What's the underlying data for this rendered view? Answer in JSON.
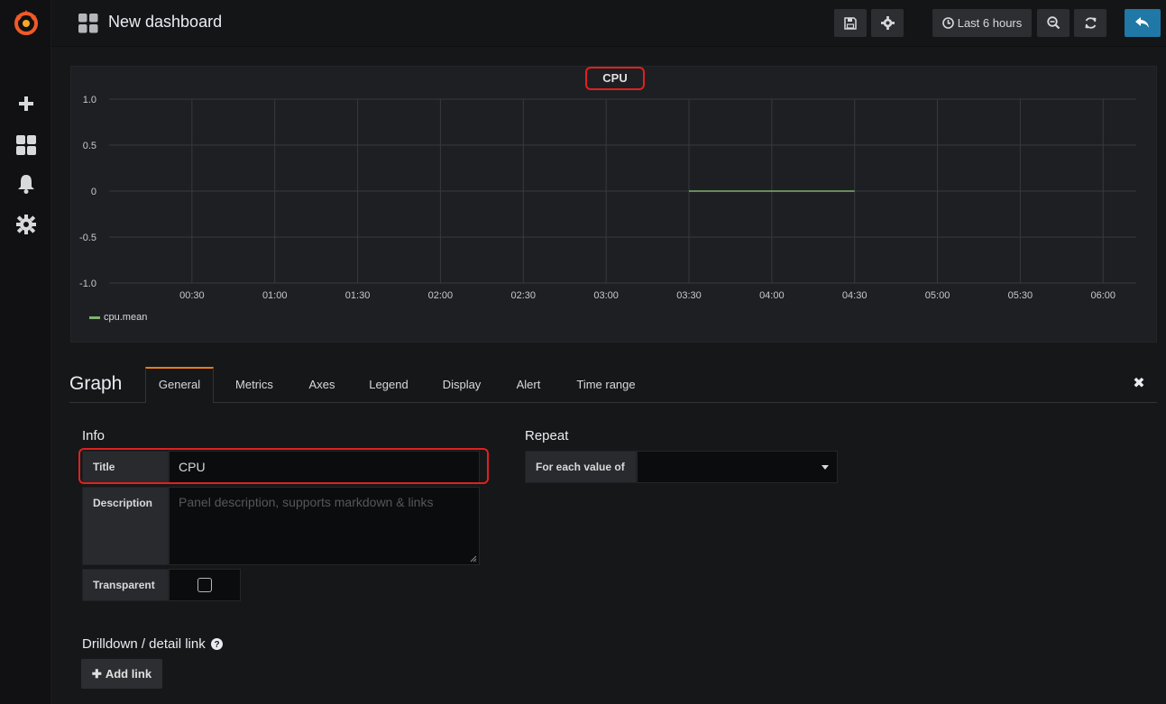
{
  "topbar": {
    "dashboard_title": "New dashboard",
    "time_range_label": "Last 6 hours"
  },
  "panel": {
    "title": "CPU"
  },
  "chart_data": {
    "type": "line",
    "y_ticks": [
      "1.0",
      "0.5",
      "0",
      "-0.5",
      "-1.0"
    ],
    "x_ticks": [
      "00:30",
      "01:00",
      "01:30",
      "02:00",
      "02:30",
      "03:00",
      "03:30",
      "04:00",
      "04:30",
      "05:00",
      "05:30",
      "06:00"
    ],
    "ylim": [
      -1.0,
      1.0
    ],
    "xlim": [
      "00:00",
      "06:12"
    ],
    "grid": true,
    "legend_position": "bottom-left",
    "series": [
      {
        "name": "cpu.mean",
        "color": "#7eb26d",
        "x": [
          "03:30",
          "04:30"
        ],
        "y": [
          0,
          0
        ]
      }
    ]
  },
  "editor": {
    "title": "Graph",
    "tabs": [
      "General",
      "Metrics",
      "Axes",
      "Legend",
      "Display",
      "Alert",
      "Time range"
    ],
    "active_tab": "General"
  },
  "info": {
    "heading": "Info",
    "title_label": "Title",
    "title_value": "CPU",
    "description_label": "Description",
    "description_placeholder": "Panel description, supports markdown & links",
    "transparent_label": "Transparent"
  },
  "repeat": {
    "heading": "Repeat",
    "for_each_label": "For each value of",
    "selected_value": ""
  },
  "drilldown": {
    "heading": "Drilldown / detail link",
    "add_link_label": "Add link"
  },
  "colors": {
    "accent": "#eb7b18",
    "primary_button": "#1f78a5",
    "highlight": "#e02020",
    "series": "#7eb26d"
  }
}
